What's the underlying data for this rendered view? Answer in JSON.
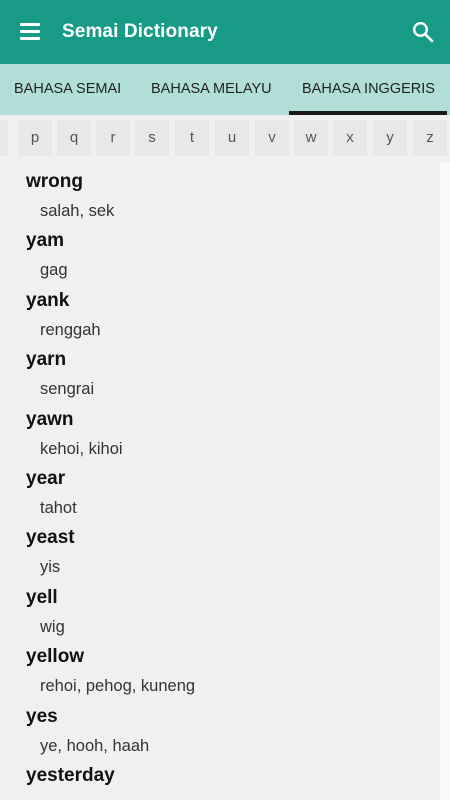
{
  "app": {
    "title": "Semai Dictionary",
    "accent_color": "#179b87",
    "tab_bar_color": "#b2ded8"
  },
  "icons": {
    "menu": "hamburger-menu-icon",
    "search": "search-icon"
  },
  "tabs": [
    {
      "label": "BAHASA SEMAI",
      "selected": false
    },
    {
      "label": "BAHASA MELAYU",
      "selected": false
    },
    {
      "label": "BAHASA INGGERIS",
      "selected": true
    }
  ],
  "letters": [
    "p",
    "q",
    "r",
    "s",
    "t",
    "u",
    "v",
    "w",
    "x",
    "y",
    "z"
  ],
  "entries": [
    {
      "word": "wrong",
      "meaning": "salah, sek"
    },
    {
      "word": "yam",
      "meaning": "gag"
    },
    {
      "word": "yank",
      "meaning": "renggah"
    },
    {
      "word": "yarn",
      "meaning": "sengrai"
    },
    {
      "word": "yawn",
      "meaning": "kehoi, kihoi"
    },
    {
      "word": "year",
      "meaning": "tahot"
    },
    {
      "word": "yeast",
      "meaning": "yis"
    },
    {
      "word": "yell",
      "meaning": "wig"
    },
    {
      "word": "yellow",
      "meaning": "rehoi, pehog, kuneng"
    },
    {
      "word": "yes",
      "meaning": "ye, hooh, haah"
    },
    {
      "word": "yesterday",
      "meaning": ""
    }
  ]
}
